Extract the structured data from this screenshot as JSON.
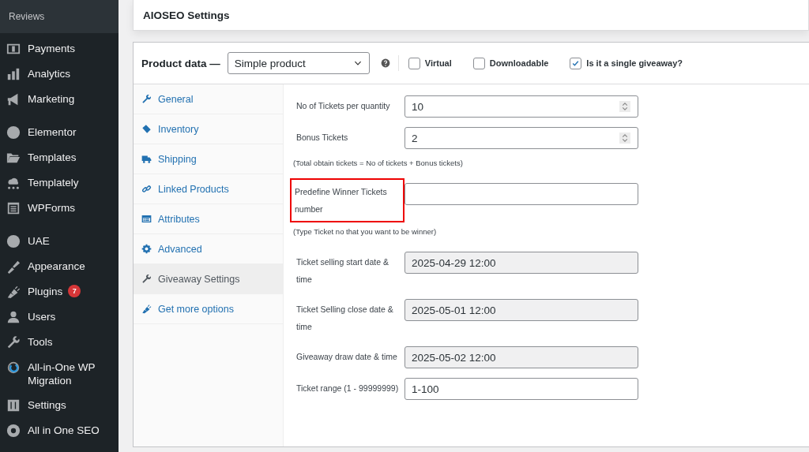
{
  "sidebar": {
    "submenu": [
      {
        "label": "Reviews"
      }
    ],
    "groups": [
      [
        {
          "label": "Payments"
        },
        {
          "label": "Analytics"
        },
        {
          "label": "Marketing"
        }
      ],
      [
        {
          "label": "Elementor"
        },
        {
          "label": "Templates"
        },
        {
          "label": "Templately"
        },
        {
          "label": "WPForms"
        }
      ],
      [
        {
          "label": "UAE"
        },
        {
          "label": "Appearance"
        },
        {
          "label": "Plugins",
          "badge": "7"
        },
        {
          "label": "Users"
        },
        {
          "label": "Tools"
        },
        {
          "label": "All-in-One WP Migration"
        },
        {
          "label": "Settings"
        },
        {
          "label": "All in One SEO"
        }
      ]
    ]
  },
  "aioseo_panel": {
    "title": "AIOSEO Settings"
  },
  "product_data": {
    "title": "Product data —",
    "type_select": "Simple product",
    "options": [
      {
        "label": "Virtual",
        "checked": false
      },
      {
        "label": "Downloadable",
        "checked": false
      },
      {
        "label": "Is it a single giveaway?",
        "checked": true
      }
    ],
    "tabs": [
      {
        "label": "General",
        "selected": false
      },
      {
        "label": "Inventory",
        "selected": false
      },
      {
        "label": "Shipping",
        "selected": false
      },
      {
        "label": "Linked Products",
        "selected": false
      },
      {
        "label": "Attributes",
        "selected": false
      },
      {
        "label": "Advanced",
        "selected": false
      },
      {
        "label": "Giveaway Settings",
        "selected": true
      },
      {
        "label": "Get more options",
        "selected": false
      }
    ],
    "fields": [
      {
        "kind": "number",
        "label": "No of Tickets per quantity",
        "value": "10"
      },
      {
        "kind": "number",
        "label": "Bonus Tickets",
        "value": "2"
      },
      {
        "kind": "note",
        "text": "(Total obtain tickets = No of tickets + Bonus tickets)"
      },
      {
        "kind": "text",
        "label": "Predefine Winner Tickets number",
        "highlighted": true
      },
      {
        "kind": "note",
        "text": "(Type Ticket no that you want to be winner)"
      },
      {
        "kind": "readonly",
        "label": "Ticket selling start date & time",
        "value": "2025-04-29 12:00"
      },
      {
        "kind": "readonly",
        "label": "Ticket Selling close date & time",
        "value": "2025-05-01 12:00"
      },
      {
        "kind": "readonly",
        "label": "Giveaway draw date & time",
        "value": "2025-05-02 12:00"
      },
      {
        "kind": "text",
        "label": "Ticket range (1 - 99999999)",
        "value": "1-100"
      }
    ]
  }
}
